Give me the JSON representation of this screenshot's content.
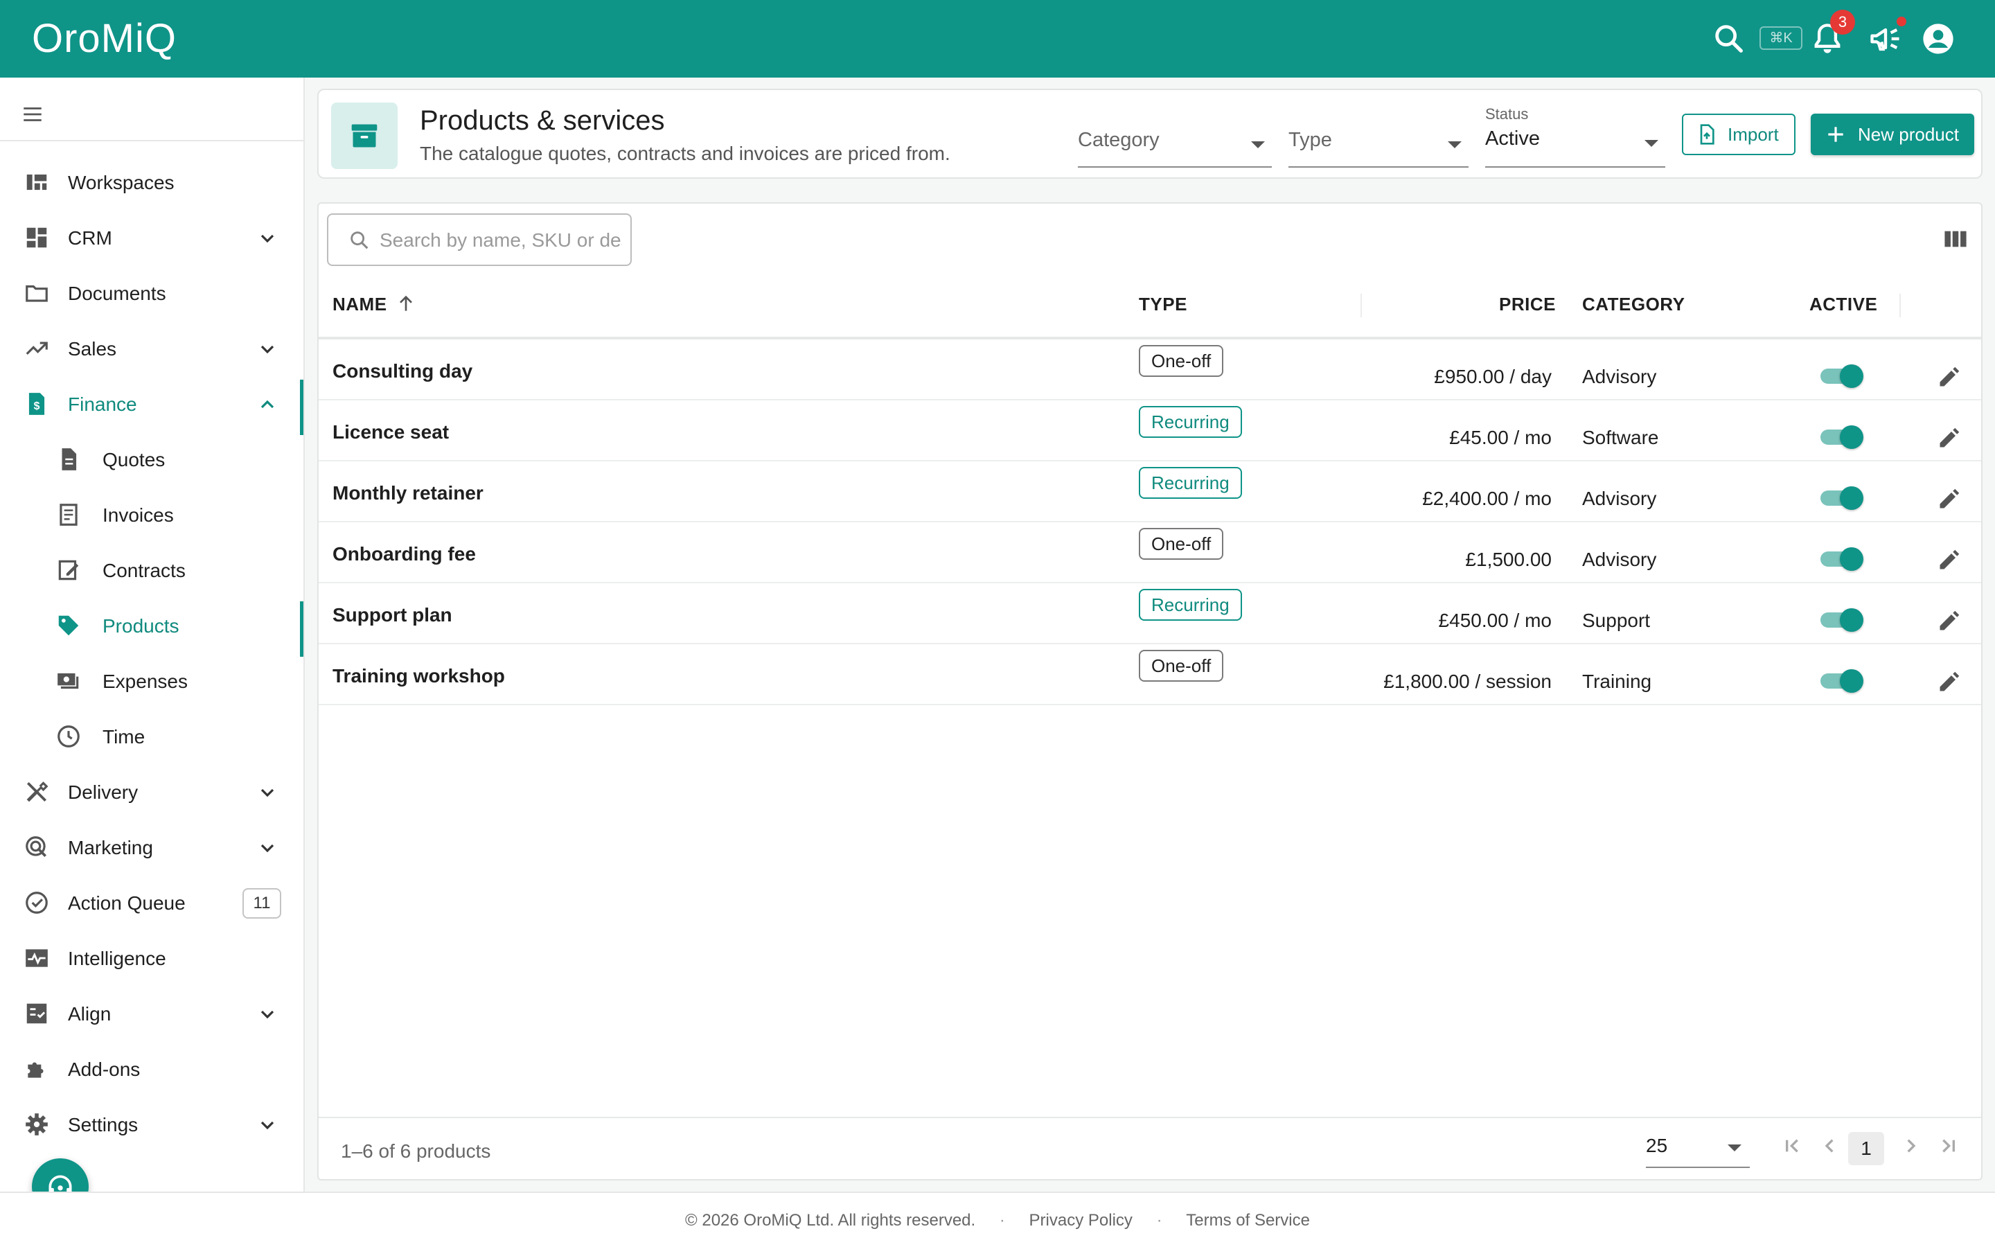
{
  "app": {
    "name": "OroMiQ"
  },
  "topbar": {
    "shortcut": "⌘K",
    "notifications_count": "3",
    "icons": [
      "search-icon",
      "bell-icon",
      "megaphone-icon",
      "account-icon"
    ]
  },
  "sidebar": {
    "items": [
      {
        "label": "Workspaces",
        "icon": "workspaces-icon"
      },
      {
        "label": "CRM",
        "icon": "dashboard-icon",
        "expandable": true
      },
      {
        "label": "Documents",
        "icon": "folder-icon"
      },
      {
        "label": "Sales",
        "icon": "trending-up-icon",
        "expandable": true
      },
      {
        "label": "Finance",
        "icon": "receipt-dollar-icon",
        "expanded": true,
        "active": true
      },
      {
        "label": "Quotes",
        "icon": "document-icon",
        "sub": true
      },
      {
        "label": "Invoices",
        "icon": "invoice-icon",
        "sub": true
      },
      {
        "label": "Contracts",
        "icon": "contract-icon",
        "sub": true
      },
      {
        "label": "Products",
        "icon": "tag-icon",
        "sub": true,
        "active": true
      },
      {
        "label": "Expenses",
        "icon": "payments-icon",
        "sub": true
      },
      {
        "label": "Time",
        "icon": "clock-icon",
        "sub": true
      },
      {
        "label": "Delivery",
        "icon": "tools-icon",
        "expandable": true
      },
      {
        "label": "Marketing",
        "icon": "target-icon",
        "expandable": true
      },
      {
        "label": "Action Queue",
        "icon": "check-circle-icon",
        "badge": "11"
      },
      {
        "label": "Intelligence",
        "icon": "pulse-icon"
      },
      {
        "label": "Align",
        "icon": "checklist-icon",
        "expandable": true
      },
      {
        "label": "Add-ons",
        "icon": "puzzle-icon"
      },
      {
        "label": "Settings",
        "icon": "gear-icon",
        "expandable": true
      }
    ]
  },
  "header": {
    "title": "Products & services",
    "subtitle": "The catalogue quotes, contracts and invoices are priced from.",
    "filters": {
      "category_placeholder": "Category",
      "type_placeholder": "Type",
      "status_label": "Status",
      "status_value": "Active"
    },
    "import_label": "Import",
    "new_label": "New product"
  },
  "table": {
    "search_placeholder": "Search by name, SKU or description",
    "columns": {
      "name": "NAME",
      "type": "TYPE",
      "price": "PRICE",
      "category": "CATEGORY",
      "active": "ACTIVE"
    },
    "rows": [
      {
        "name": "Consulting day",
        "type": "One-off",
        "recurring": false,
        "price": "£950.00 / day",
        "category": "Advisory",
        "active": true
      },
      {
        "name": "Licence seat",
        "type": "Recurring",
        "recurring": true,
        "price": "£45.00 / mo",
        "category": "Software",
        "active": true
      },
      {
        "name": "Monthly retainer",
        "type": "Recurring",
        "recurring": true,
        "price": "£2,400.00 / mo",
        "category": "Advisory",
        "active": true
      },
      {
        "name": "Onboarding fee",
        "type": "One-off",
        "recurring": false,
        "price": "£1,500.00",
        "category": "Advisory",
        "active": true
      },
      {
        "name": "Support plan",
        "type": "Recurring",
        "recurring": true,
        "price": "£450.00 / mo",
        "category": "Support",
        "active": true
      },
      {
        "name": "Training workshop",
        "type": "One-off",
        "recurring": false,
        "price": "£1,800.00 / session",
        "category": "Training",
        "active": true
      }
    ],
    "footer": {
      "summary": "1–6 of 6 products",
      "per_page": "25",
      "current_page": "1"
    }
  },
  "footer": {
    "copyright": "© 2026 OroMiQ Ltd. All rights reserved.",
    "separator": "·",
    "privacy": "Privacy Policy",
    "terms": "Terms of Service"
  },
  "colors": {
    "brand": "#0f9488",
    "accent_text": "#0f8a7e",
    "badge_red": "#e53935"
  }
}
